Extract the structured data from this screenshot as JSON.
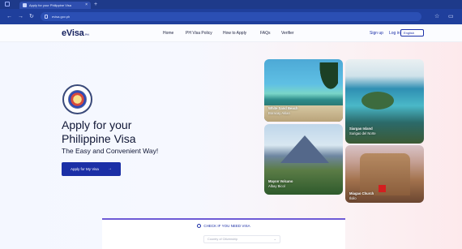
{
  "browser": {
    "tab_title": "Apply for your Philippine Visa",
    "new_tab": "+",
    "url": "evisa.gov.ph",
    "nav": {
      "back": "←",
      "forward": "→",
      "reload": "↻"
    }
  },
  "site": {
    "logo_text": "eVisa",
    "logo_suffix": "PH",
    "menu": [
      "Home",
      "PH Visa Policy",
      "How to Apply",
      "FAQs",
      "Verifier"
    ],
    "signup": "Sign up",
    "login": "Log in",
    "language": "English"
  },
  "hero": {
    "title_line1": "Apply for your",
    "title_line2": "Philippine Visa",
    "subtitle": "The Easy and Convenient Way!",
    "cta_label": "Apply for My Visa",
    "cta_arrow": "→"
  },
  "cards": [
    {
      "title": "White Sand Beach",
      "subtitle": "Boracay Aklan"
    },
    {
      "title": "Mayon Volcano",
      "subtitle": "Albay Bicol"
    },
    {
      "title": "Siargao Island",
      "subtitle": "Surigao del Norte"
    },
    {
      "title": "Miagao Church",
      "subtitle": "Iloilo"
    }
  ],
  "check_panel": {
    "title": "CHECK IF YOU NEED VISA",
    "select_placeholder": "Country of Citizenship",
    "select_chevron": "⌄"
  },
  "colors": {
    "browser_chrome": "#1f3f9c",
    "primary": "#1b2fa6",
    "text_dark": "#101735",
    "accent_red": "#d31f1f"
  }
}
